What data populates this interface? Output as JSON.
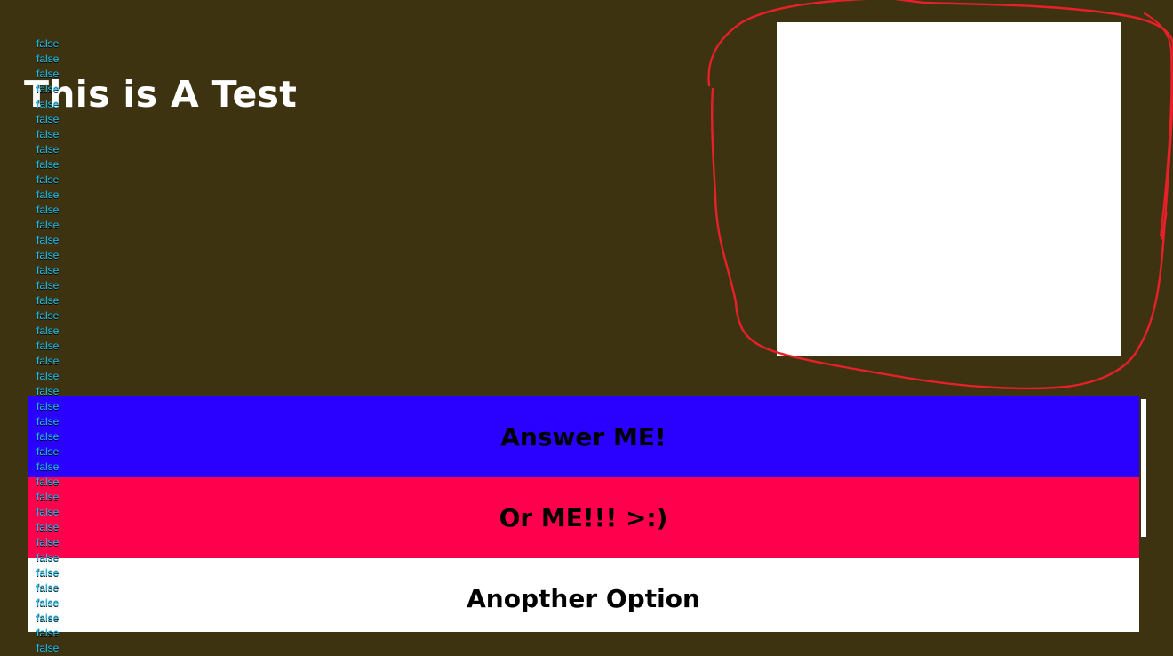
{
  "page": {
    "title": "This is A Test",
    "background_color": "#3d3310"
  },
  "answers": [
    {
      "label": "Answer ME!",
      "color": "#2a00ff"
    },
    {
      "label": "Or ME!!! >:)",
      "color": "#ff004d"
    },
    {
      "label": "Anopther Option",
      "color": "#ffffff"
    }
  ],
  "debug_log": {
    "value": "false",
    "color": "#1fc2f2",
    "lines": [
      "false",
      "false",
      "false",
      "false",
      "false",
      "false",
      "false",
      "false",
      "false",
      "false",
      "false",
      "false",
      "false",
      "false",
      "false",
      "false",
      "false",
      "false",
      "false",
      "false",
      "false",
      "false",
      "false",
      "false",
      "false",
      "false",
      "false",
      "false",
      "false",
      "false",
      "false",
      "false",
      "false",
      "false",
      "false",
      "false",
      "false",
      "false",
      "false",
      "false",
      "false"
    ]
  },
  "annotation": {
    "shape": "freehand-circle",
    "color": "#e8202a"
  }
}
